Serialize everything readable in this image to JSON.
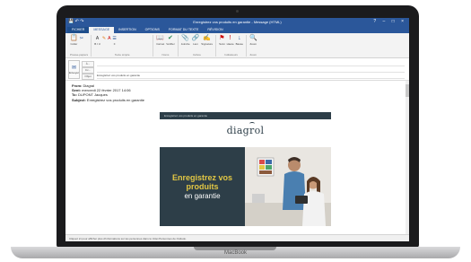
{
  "window": {
    "title": "Enregistrez vos produits en garantie - Message (HTML)",
    "qat_icons": [
      "save-icon",
      "undo-icon",
      "redo-icon"
    ],
    "controls": [
      "?",
      "–",
      "□",
      "×"
    ]
  },
  "tabs": [
    {
      "label": "FICHIER"
    },
    {
      "label": "MESSAGE"
    },
    {
      "label": "INSERTION"
    },
    {
      "label": "OPTIONS"
    },
    {
      "label": "FORMAT DU TEXTE"
    },
    {
      "label": "RÉVISION"
    }
  ],
  "ribbon": {
    "groups": [
      {
        "name": "Presse-papiers",
        "buttons": [
          {
            "label": "Coller",
            "icon": "paste-icon"
          }
        ]
      },
      {
        "name": "Texte simple",
        "buttons": [
          {
            "label": "B I U",
            "icon": "font-icon"
          },
          {
            "label": "≡",
            "icon": "align-icon"
          }
        ]
      },
      {
        "name": "Noms",
        "buttons": [
          {
            "label": "Carnet",
            "icon": "address-book-icon"
          },
          {
            "label": "Vérifier",
            "icon": "check-names-icon"
          }
        ]
      },
      {
        "name": "Inclure",
        "buttons": [
          {
            "label": "Joindre",
            "icon": "attach-icon"
          },
          {
            "label": "Lien",
            "icon": "link-icon"
          },
          {
            "label": "Signature",
            "icon": "signature-icon"
          }
        ]
      },
      {
        "name": "Indicateurs",
        "buttons": [
          {
            "label": "Suivi",
            "icon": "flag-icon"
          },
          {
            "label": "Haute",
            "icon": "importance-high-icon"
          },
          {
            "label": "Basse",
            "icon": "importance-low-icon"
          }
        ]
      },
      {
        "name": "Zoom",
        "buttons": [
          {
            "label": "Zoom",
            "icon": "zoom-icon"
          }
        ]
      }
    ]
  },
  "compose": {
    "send_label": "Envoyer",
    "to_label": "À...",
    "to_value": "",
    "cc_label": "Cc...",
    "cc_value": "",
    "subject_label": "Objet",
    "subject_value": "Enregistrez vos produits en garantie"
  },
  "forwarded": {
    "from_label": "From:",
    "from_value": "Diagral",
    "sent_label": "Sent:",
    "sent_value": "mercredi 22 février 2017 14:06",
    "to_label": "To:",
    "to_value": "DUPONT Jacques",
    "subject_label": "Subject:",
    "subject_value": "Enregistrez vos produits en garantie"
  },
  "newsletter": {
    "topbar_text": "Enregistrez vos produits en garantie",
    "logo": "diagrol",
    "headline": "Enregistrez vos produits",
    "subline": "en garantie",
    "colors": {
      "panel": "#2d3e48",
      "headline": "#e2c744"
    }
  },
  "statusbar": {
    "text": "Cliquez ici pour afficher plus d'informations sur les personnes dans le Volet Personnes de Outlook."
  },
  "laptop": {
    "brand": "MacBook"
  }
}
